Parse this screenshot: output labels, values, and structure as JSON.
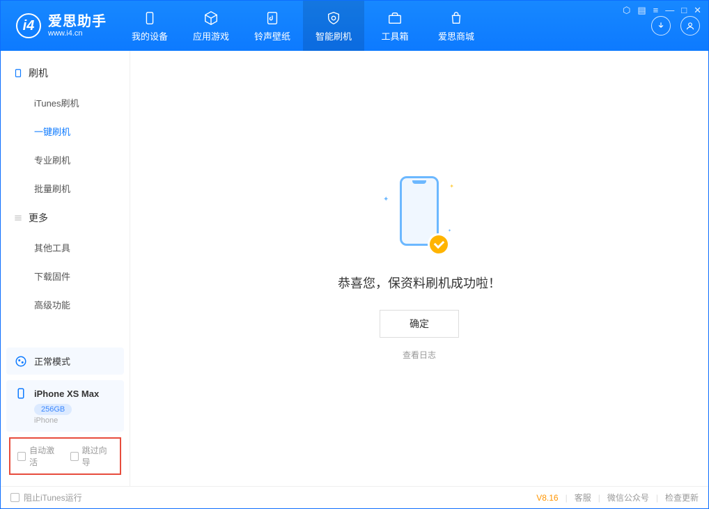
{
  "app": {
    "title": "爱思助手",
    "subtitle": "www.i4.cn"
  },
  "nav": {
    "my_device": "我的设备",
    "apps": "应用游戏",
    "ringtones": "铃声壁纸",
    "flash": "智能刷机",
    "toolbox": "工具箱",
    "store": "爱思商城"
  },
  "sidebar": {
    "group_flash": "刷机",
    "itunes_flash": "iTunes刷机",
    "one_click_flash": "一键刷机",
    "pro_flash": "专业刷机",
    "batch_flash": "批量刷机",
    "group_more": "更多",
    "other_tools": "其他工具",
    "download_fw": "下载固件",
    "advanced": "高级功能",
    "mode": "正常模式",
    "device_name": "iPhone XS Max",
    "device_storage": "256GB",
    "device_type": "iPhone",
    "auto_activate": "自动激活",
    "skip_guide": "跳过向导"
  },
  "main": {
    "success_msg": "恭喜您，保资料刷机成功啦！",
    "confirm": "确定",
    "view_log": "查看日志"
  },
  "footer": {
    "block_itunes": "阻止iTunes运行",
    "version": "V8.16",
    "support": "客服",
    "wechat": "微信公众号",
    "update": "检查更新"
  }
}
